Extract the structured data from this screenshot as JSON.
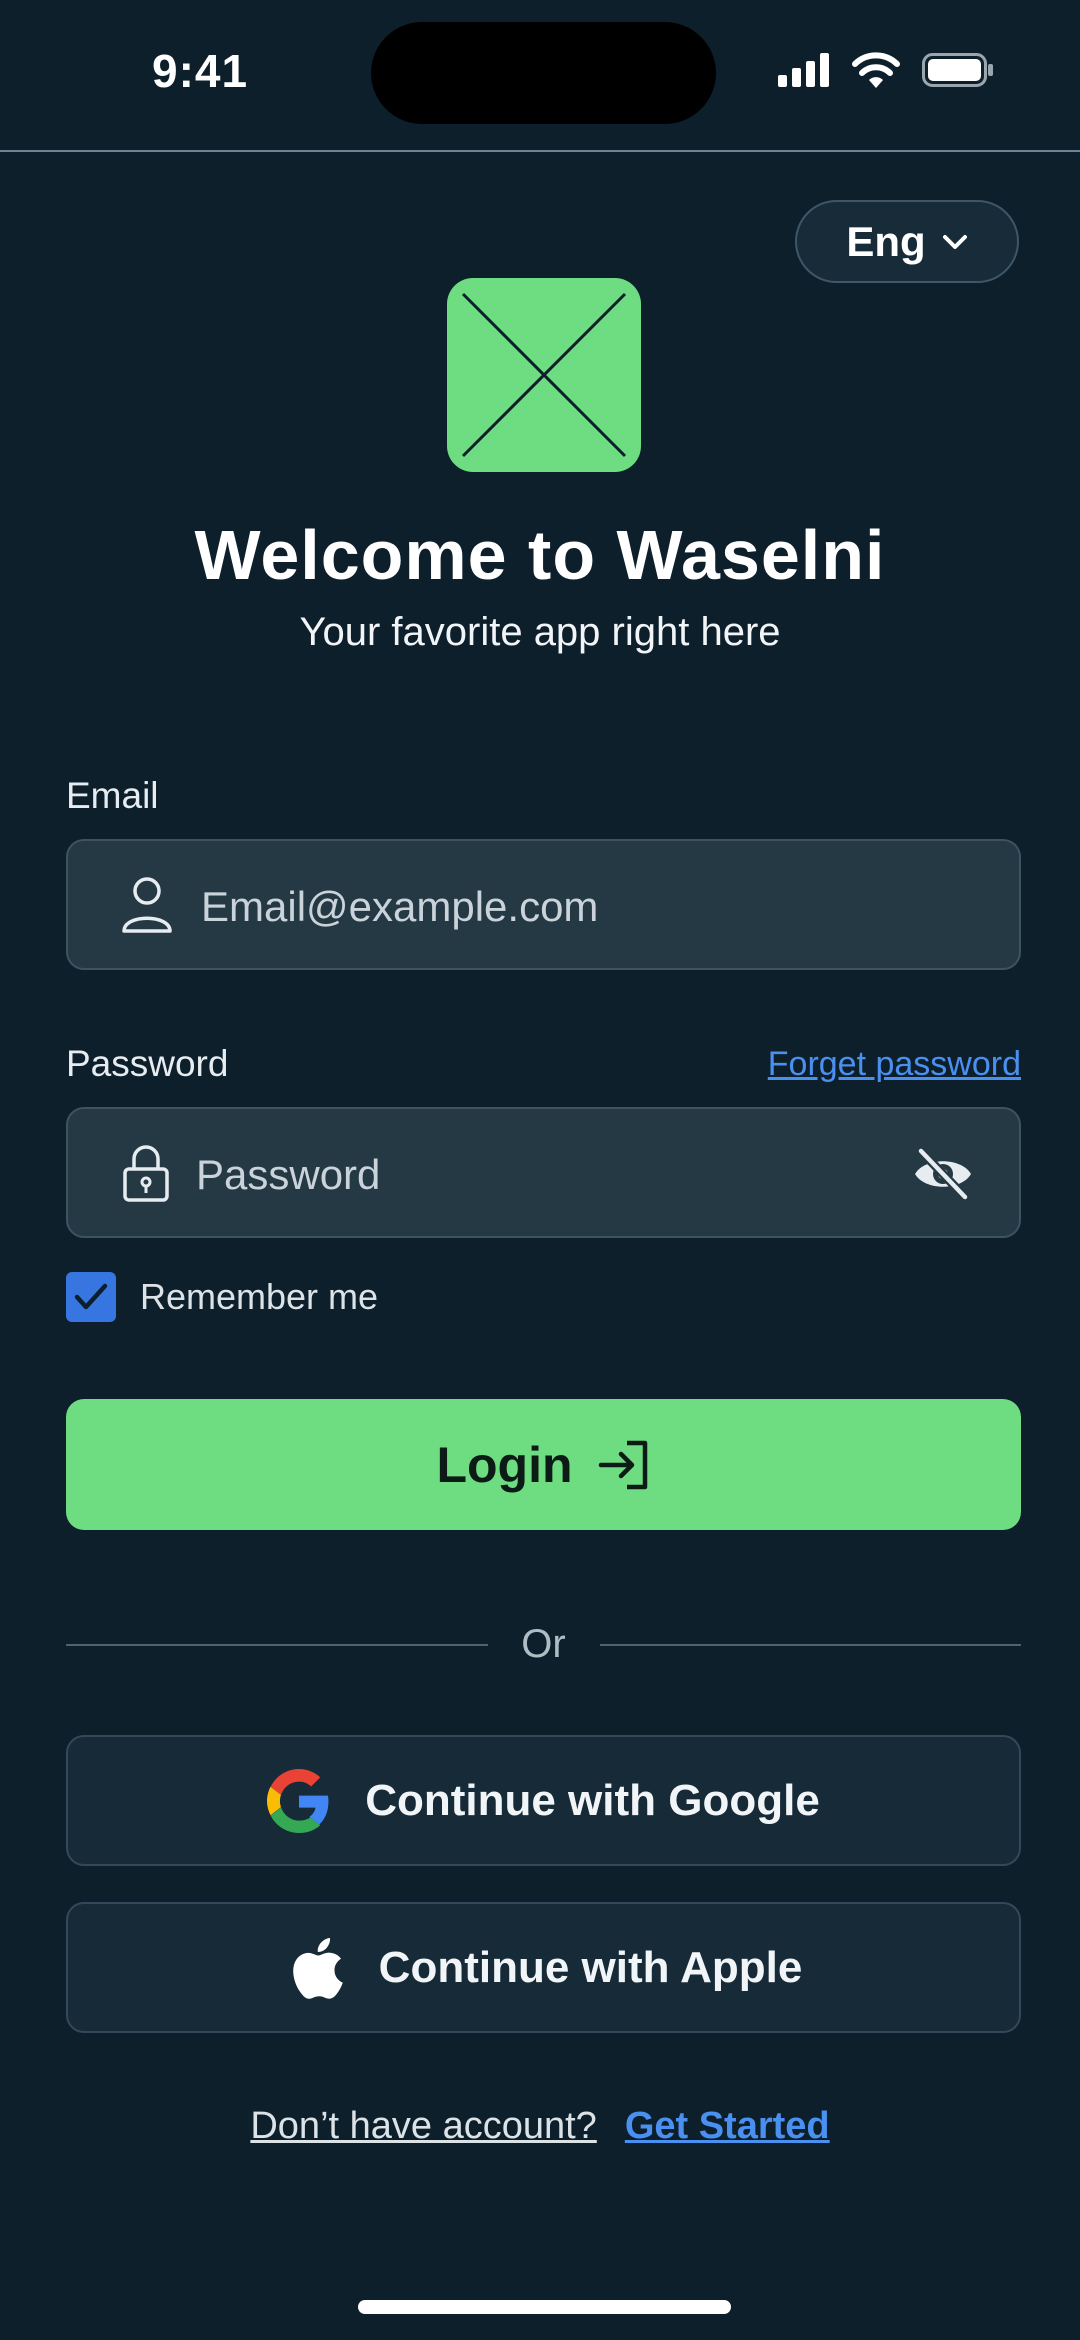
{
  "status_bar": {
    "time": "9:41"
  },
  "language": {
    "selected": "Eng"
  },
  "header": {
    "title": "Welcome to Waselni",
    "subtitle": "Your favorite app right here"
  },
  "form": {
    "email": {
      "label": "Email",
      "placeholder": "Email@example.com"
    },
    "password": {
      "label": "Password",
      "placeholder": "Password",
      "forgot_link": "Forget password"
    },
    "remember_me": {
      "label": "Remember me",
      "checked": true
    },
    "login_label": "Login"
  },
  "divider": {
    "text": "Or"
  },
  "social": {
    "google_label": "Continue with Google",
    "apple_label": "Continue with Apple"
  },
  "footer": {
    "prompt": "Don’t have account?",
    "link": "Get Started"
  },
  "colors": {
    "background": "#0e1f2c",
    "accent_green": "#6edc81",
    "link_blue": "#4a90f0",
    "checkbox_blue": "#3775e0"
  }
}
